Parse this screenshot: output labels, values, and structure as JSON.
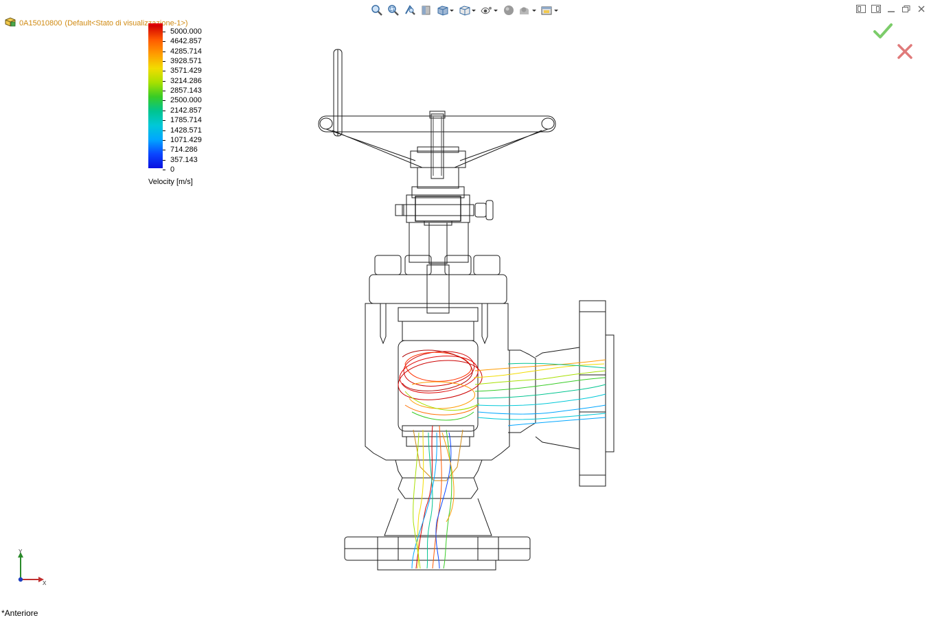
{
  "tree": {
    "model_name": "0A15010800",
    "config": "(Default<Stato di visualizzazione-1>)"
  },
  "toolbar": {
    "buttons": [
      {
        "name": "zoom-to-fit",
        "icon": "zoom-fit-icon"
      },
      {
        "name": "zoom-to-area",
        "icon": "zoom-area-icon"
      },
      {
        "name": "previous-view",
        "icon": "previous-view-icon"
      },
      {
        "name": "section-view",
        "icon": "section-view-icon"
      },
      {
        "name": "view-orientation",
        "icon": "view-orientation-icon"
      },
      {
        "name": "display-style",
        "icon": "display-style-icon"
      },
      {
        "name": "hide-show-items",
        "icon": "hide-show-icon"
      },
      {
        "name": "edit-appearance",
        "icon": "appearance-icon"
      },
      {
        "name": "apply-scene",
        "icon": "scene-icon"
      },
      {
        "name": "view-settings",
        "icon": "view-settings-icon"
      }
    ]
  },
  "legend": {
    "title": "Velocity [m/s]",
    "values": [
      "5000.000",
      "4642.857",
      "4285.714",
      "3928.571",
      "3571.429",
      "3214.286",
      "2857.143",
      "2500.000",
      "2142.857",
      "1785.714",
      "1428.571",
      "1071.429",
      "714.286",
      "357.143",
      "0"
    ],
    "colors": {
      "max": "#d10000",
      "mid": "#38cc26",
      "min": "#0a10e0"
    }
  },
  "triad": {
    "x_label": "X",
    "y_label": "Y"
  },
  "view": {
    "name": "*Anteriore"
  },
  "colors": {
    "accent": "#d08a12",
    "confirm": "#7ccc6a",
    "cancel": "#e07a7a",
    "wireframe": "#1a1a1a"
  }
}
